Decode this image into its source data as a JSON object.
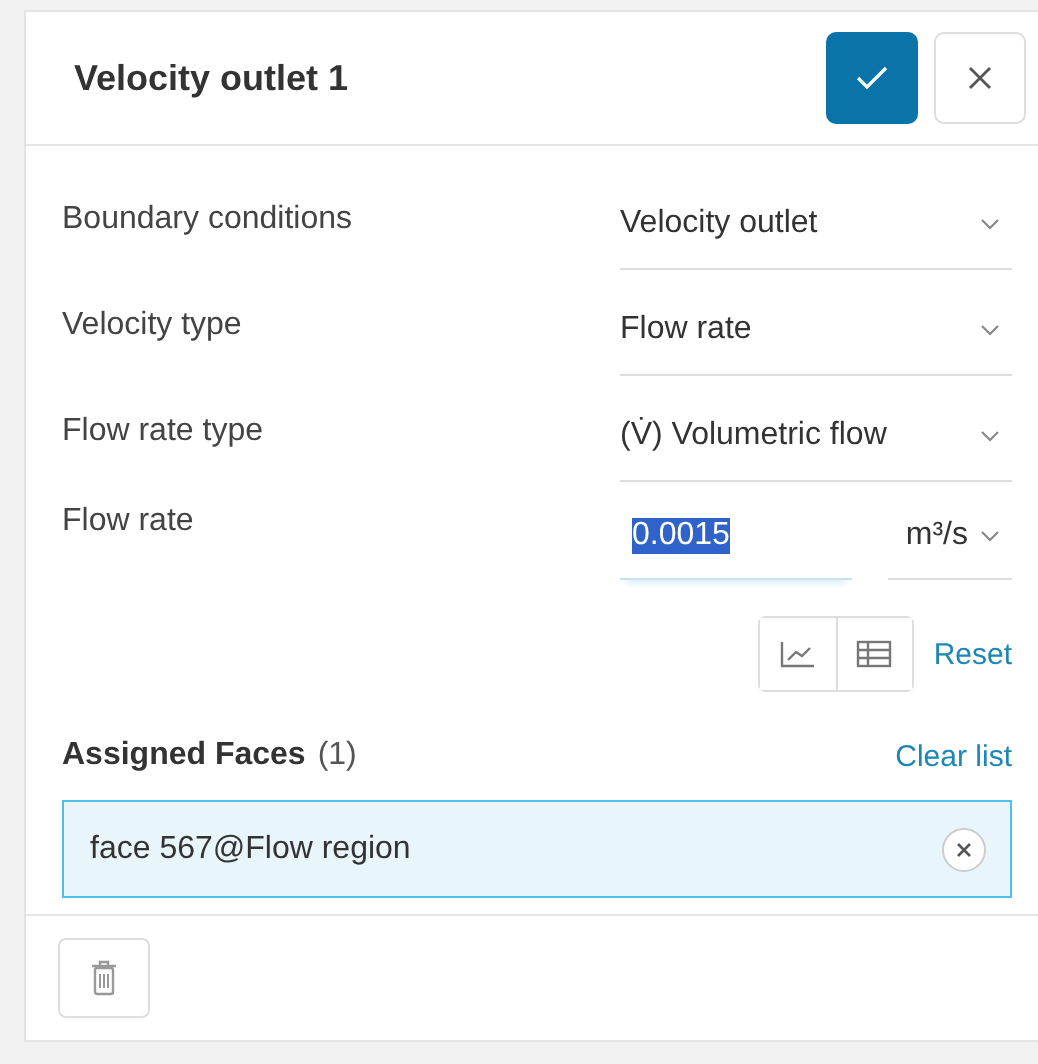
{
  "panel": {
    "title": "Velocity outlet 1"
  },
  "fields": [
    {
      "kind": "select",
      "label": "Boundary conditions",
      "value": "Velocity outlet"
    },
    {
      "kind": "select",
      "label": "Velocity type",
      "value": "Flow rate"
    },
    {
      "kind": "select",
      "label": "Flow rate type",
      "value": "(V̇) Volumetric flow"
    },
    {
      "kind": "number",
      "label": "Flow rate",
      "value": "0.0015",
      "text_selected": true,
      "unit": "m³/s"
    }
  ],
  "reset_link": "Reset",
  "assigned": {
    "title": "Assigned Faces",
    "count": "(1)",
    "clear_link": "Clear list",
    "items": [
      {
        "label": "face 567@Flow region",
        "selected": true
      }
    ]
  }
}
